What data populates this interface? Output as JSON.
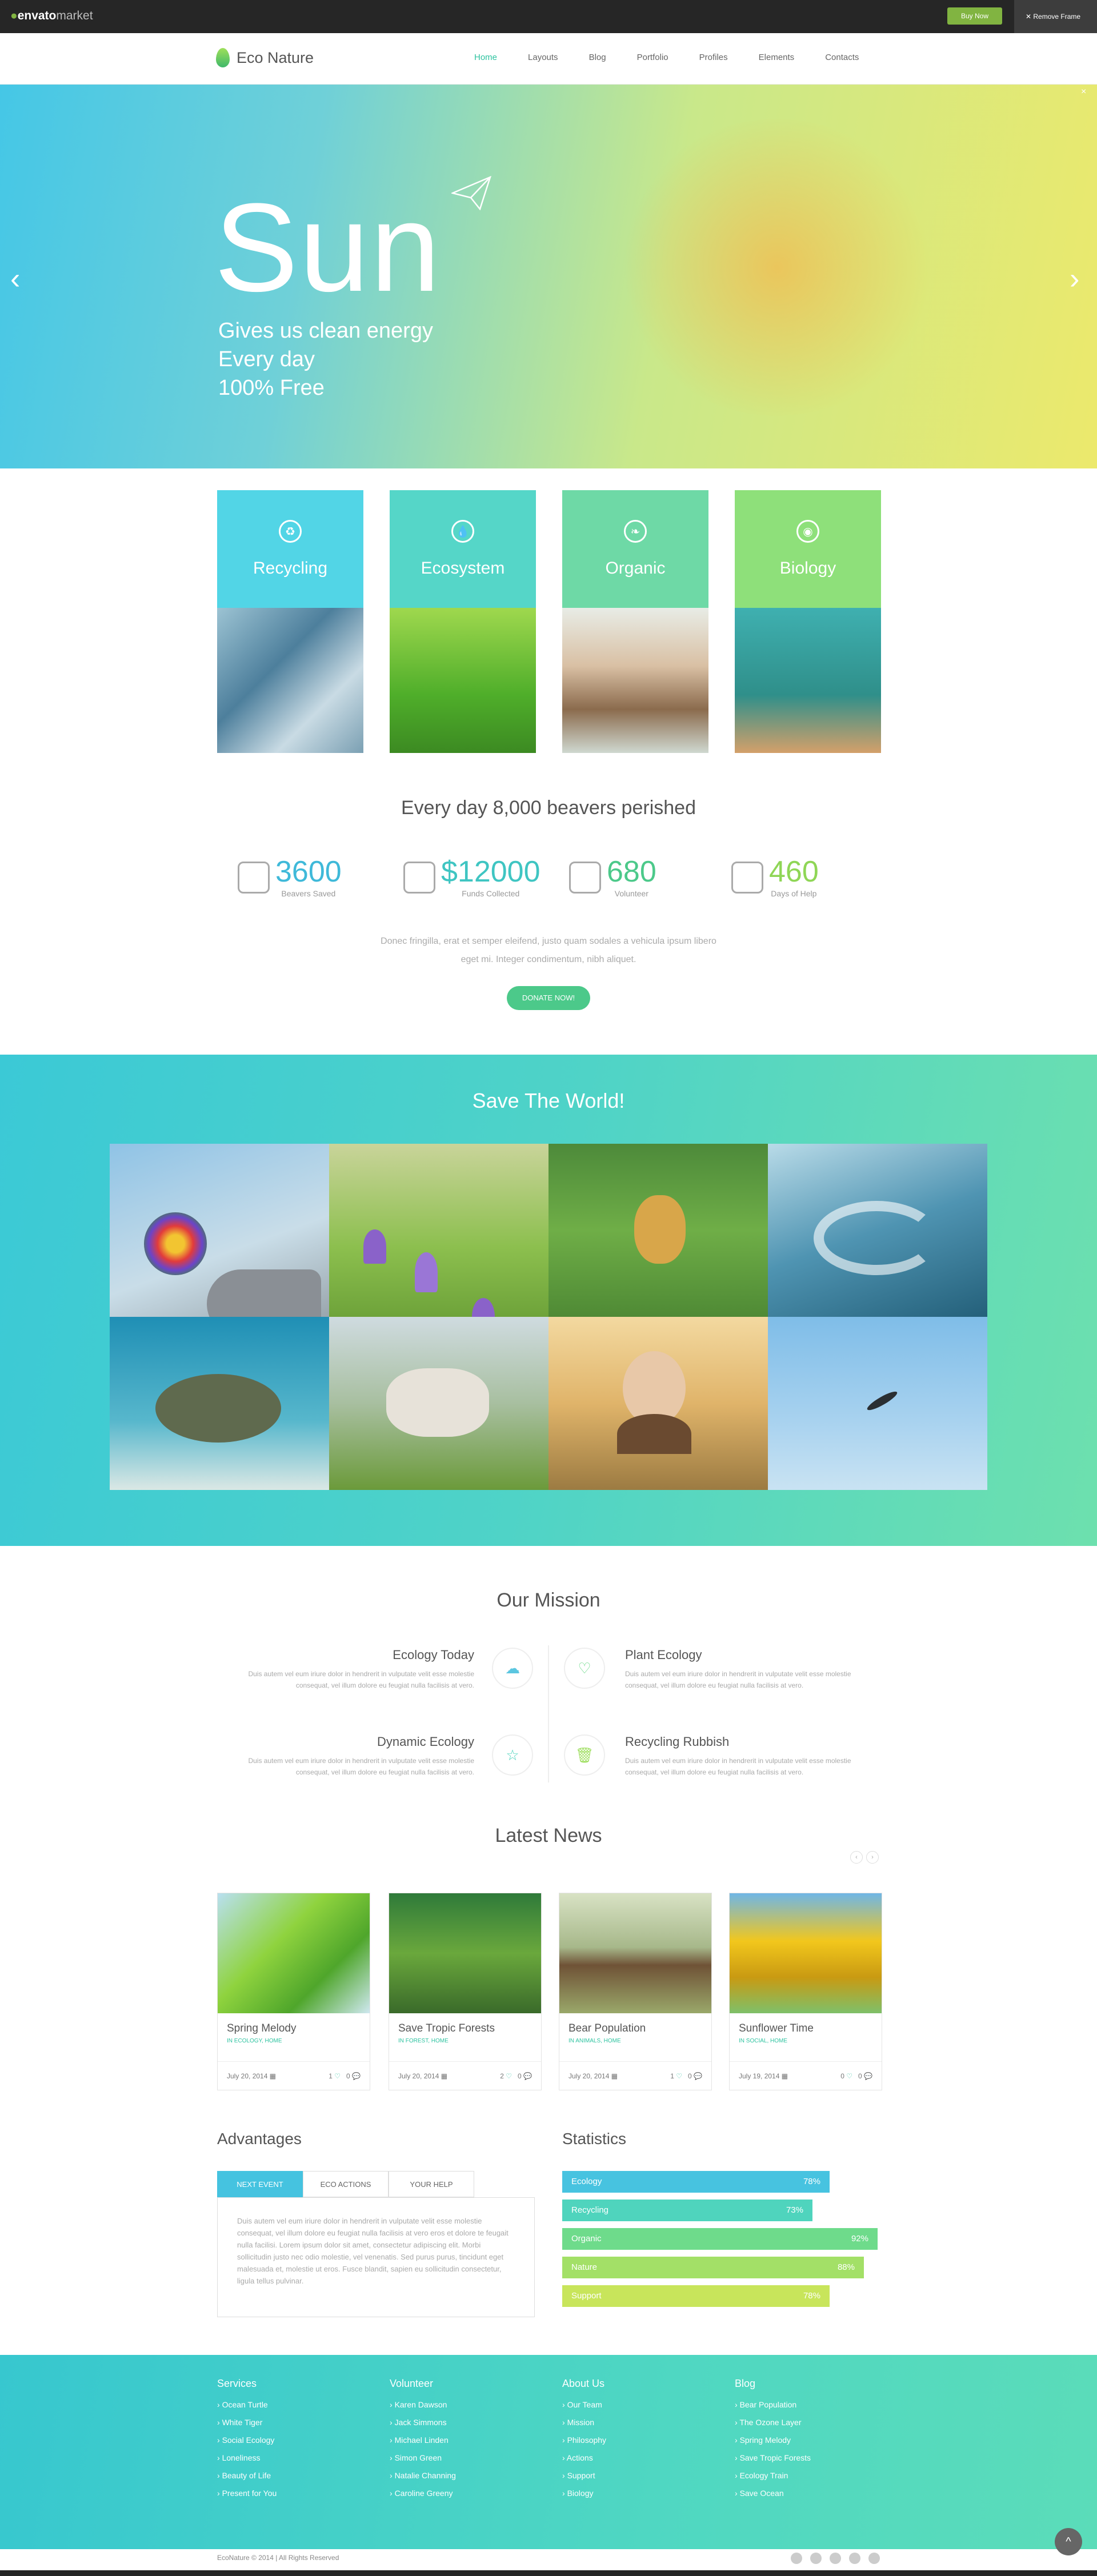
{
  "envato": {
    "logo": "envato",
    "logo_market": "market",
    "buy": "Buy Now",
    "remove": "Remove Frame"
  },
  "brand": {
    "name": "Eco Nature"
  },
  "menu": [
    "Home",
    "Layouts",
    "Blog",
    "Portfolio",
    "Profiles",
    "Elements",
    "Contacts"
  ],
  "hero": {
    "title": "Sun",
    "lines": [
      "Gives us clean energy",
      "Every day",
      "100% Free"
    ],
    "prev": "‹",
    "next": "›",
    "close": "×"
  },
  "features": [
    {
      "title": "Recycling",
      "icon": "recycle-icon",
      "glyph": "♻",
      "color": "#52d5e6"
    },
    {
      "title": "Ecosystem",
      "icon": "water-drop-icon",
      "glyph": "💧",
      "color": "#55d6c8"
    },
    {
      "title": "Organic",
      "icon": "leaf-icon",
      "glyph": "❧",
      "color": "#6ed9a6"
    },
    {
      "title": "Biology",
      "icon": "globe-icon",
      "glyph": "◉",
      "color": "#8ee07a"
    }
  ],
  "beavers": {
    "title": "Every day 8,000 beavers perished"
  },
  "stats": [
    {
      "value": "3600",
      "label": "Beavers Saved",
      "color": "#3fb9d9"
    },
    {
      "value": "$12000",
      "label": "Funds Collected",
      "color": "#3fc5c2"
    },
    {
      "value": "680",
      "label": "Volunteer",
      "color": "#4cc98a"
    },
    {
      "value": "460",
      "label": "Days of Help",
      "color": "#8fd656"
    }
  ],
  "donate": {
    "text": "Donec fringilla, erat et semper eleifend, justo quam sodales a vehicula ipsum libero eget mi. Integer condimentum, nibh aliquet.",
    "button": "DONATE NOW!"
  },
  "world": {
    "title": "Save The World!"
  },
  "mission": {
    "title": "Our Mission",
    "items": [
      {
        "title": "Ecology Today",
        "text": "Duis autem vel eum iriure dolor in hendrerit in vulputate velit esse molestie consequat, vel illum dolore eu feugiat nulla facilisis at vero."
      },
      {
        "title": "Plant Ecology",
        "text": "Duis autem vel eum iriure dolor in hendrerit in vulputate velit esse molestie consequat, vel illum dolore eu feugiat nulla facilisis at vero."
      },
      {
        "title": "Dynamic Ecology",
        "text": "Duis autem vel eum iriure dolor in hendrerit in vulputate velit esse molestie consequat, vel illum dolore eu feugiat nulla facilisis at vero."
      },
      {
        "title": "Recycling Rubbish",
        "text": "Duis autem vel eum iriure dolor in hendrerit in vulputate velit esse molestie consequat, vel illum dolore eu feugiat nulla facilisis at vero."
      }
    ]
  },
  "news": {
    "title": "Latest News",
    "items": [
      {
        "title": "Spring Melody",
        "cat": "IN ECOLOGY, HOME",
        "date": "July 20, 2014",
        "likes": "1",
        "comments": "0"
      },
      {
        "title": "Save Tropic Forests",
        "cat": "IN FOREST, HOME",
        "date": "July 20, 2014",
        "likes": "2",
        "comments": "0"
      },
      {
        "title": "Bear Population",
        "cat": "IN ANIMALS, HOME",
        "date": "July 20, 2014",
        "likes": "1",
        "comments": "0"
      },
      {
        "title": "Sunflower Time",
        "cat": "IN SOCIAL, HOME",
        "date": "July 19, 2014",
        "likes": "0",
        "comments": "0"
      }
    ]
  },
  "advantages": {
    "title": "Advantages",
    "tabs": [
      "NEXT EVENT",
      "ECO ACTIONS",
      "YOUR HELP"
    ],
    "text": "Duis autem vel eum iriure dolor in hendrerit in vulputate velit esse molestie consequat, vel illum dolore eu feugiat nulla facilisis at vero eros et dolore te feugait nulla facilisi. Lorem ipsum dolor sit amet, consectetur adipiscing elit. Morbi sollicitudin justo nec odio molestie, vel venenatis. Sed purus purus, tincidunt eget malesuada et, molestie ut eros. Fusce blandit, sapien eu sollicitudin consectetur, ligula tellus pulvinar."
  },
  "statistics": {
    "title": "Statistics",
    "bars": [
      {
        "label": "Ecology",
        "value": "78%",
        "fraction": 0.78,
        "color": "#47c3e0"
      },
      {
        "label": "Recycling",
        "value": "73%",
        "fraction": 0.73,
        "color": "#4fd4bd"
      },
      {
        "label": "Organic",
        "value": "92%",
        "fraction": 0.92,
        "color": "#6edb8b"
      },
      {
        "label": "Nature",
        "value": "88%",
        "fraction": 0.88,
        "color": "#a3e067"
      },
      {
        "label": "Support",
        "value": "78%",
        "fraction": 0.78,
        "color": "#c8e55b"
      }
    ]
  },
  "footer": {
    "cols": [
      {
        "title": "Services",
        "items": [
          "Ocean Turtle",
          "White Tiger",
          "Social Ecology",
          "Loneliness",
          "Beauty of Life",
          "Present for You"
        ]
      },
      {
        "title": "Volunteer",
        "items": [
          "Karen Dawson",
          "Jack Simmons",
          "Michael Linden",
          "Simon Green",
          "Natalie Channing",
          "Caroline Greeny"
        ]
      },
      {
        "title": "About Us",
        "items": [
          "Our Team",
          "Mission",
          "Philosophy",
          "Actions",
          "Support",
          "Biology"
        ]
      },
      {
        "title": "Blog",
        "items": [
          "Bear Population",
          "The Ozone Layer",
          "Spring Melody",
          "Save Tropic Forests",
          "Ecology Train",
          "Save Ocean"
        ]
      }
    ],
    "copyright": "EcoNature © 2014 | All Rights Reserved",
    "totop": "^"
  }
}
